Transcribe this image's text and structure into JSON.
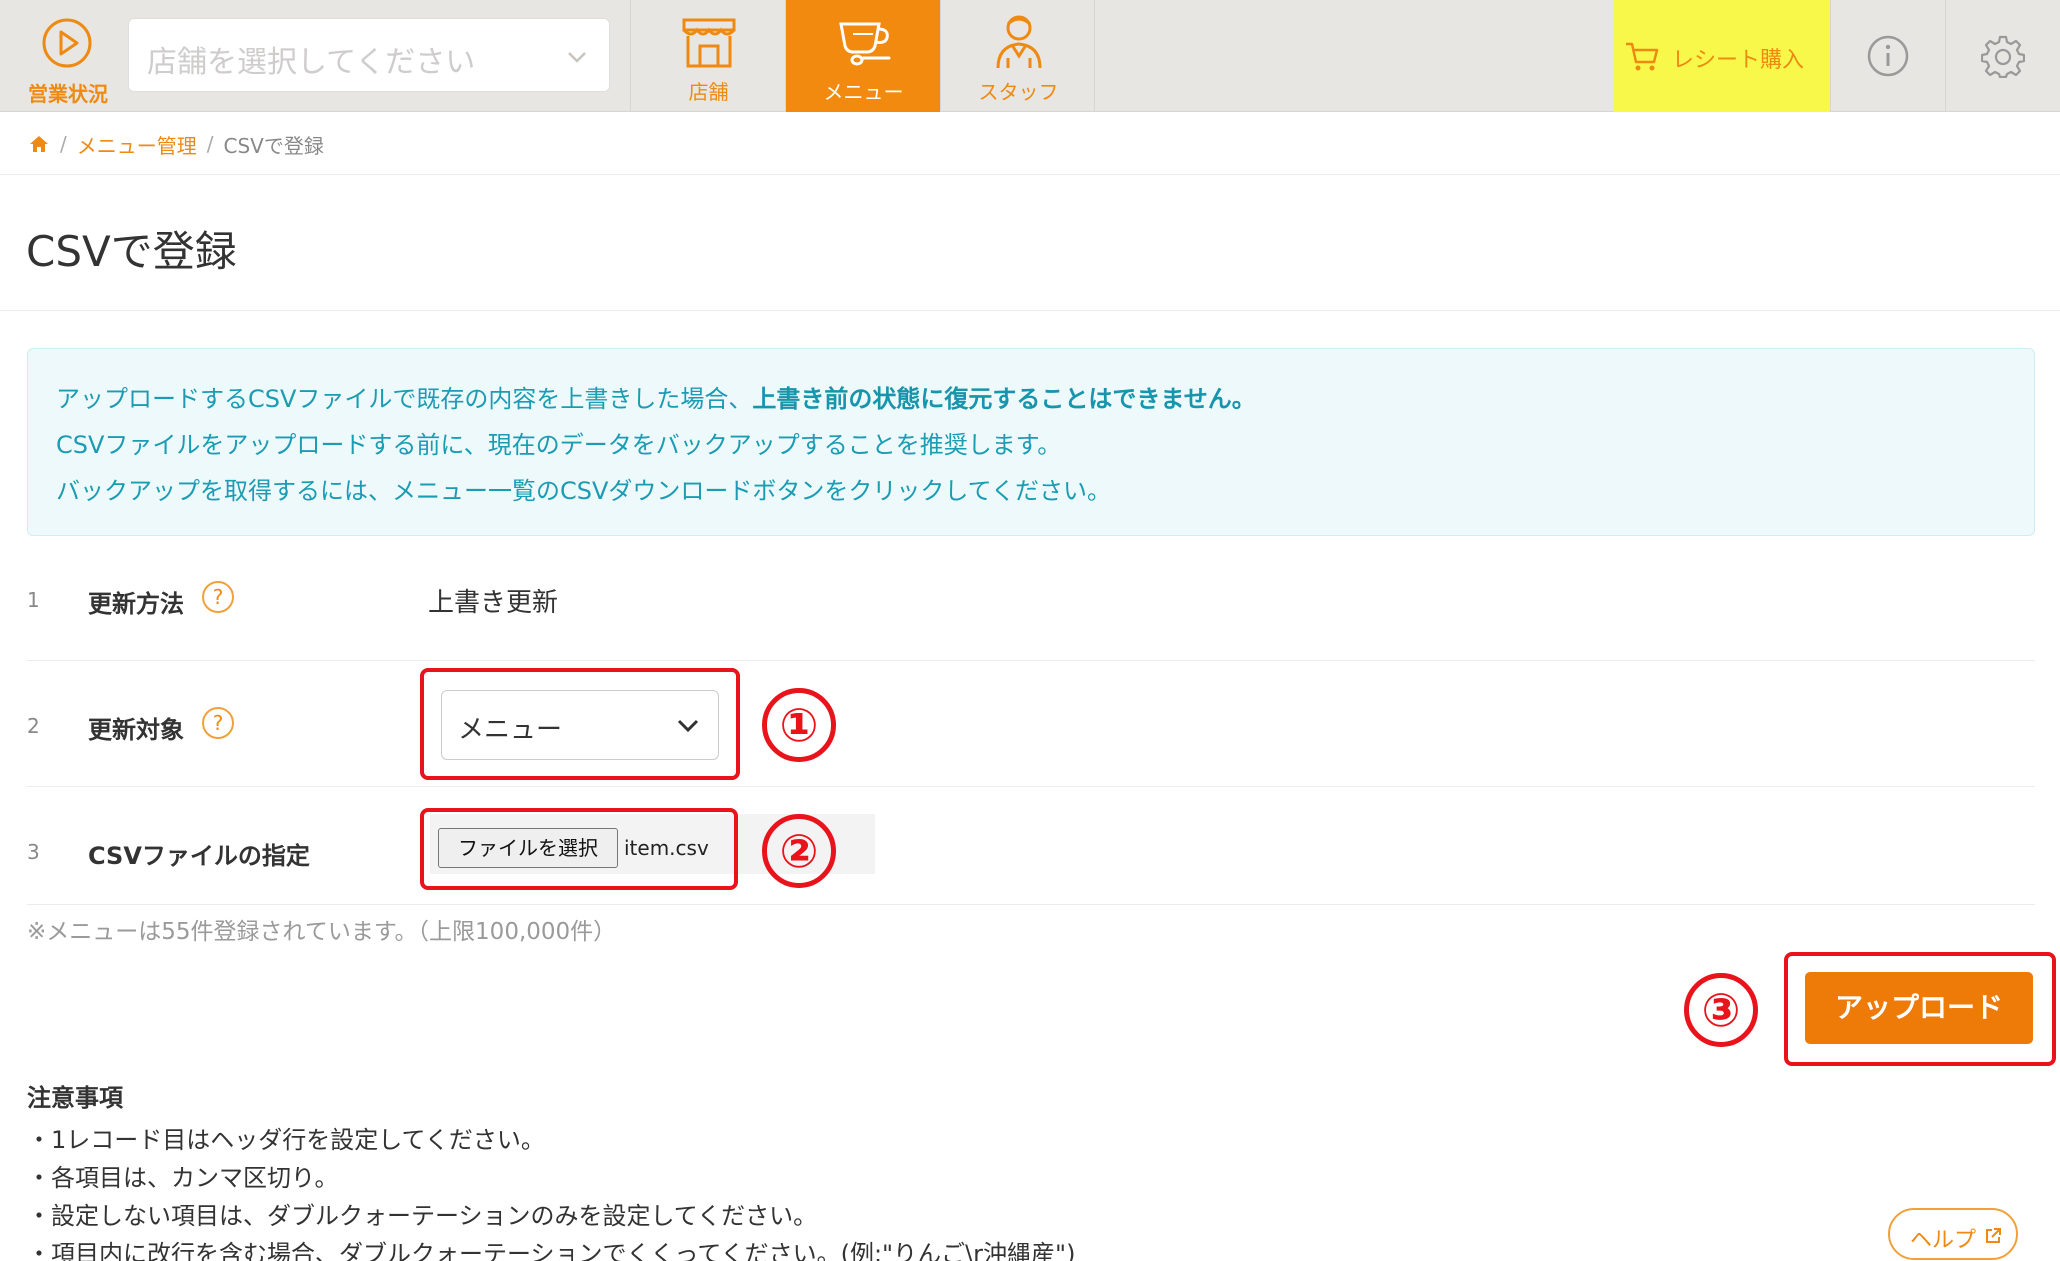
{
  "header": {
    "status_label": "営業状況",
    "store_select": {
      "placeholder": "店舗を選択してください"
    },
    "tabs": [
      {
        "label": "店舗",
        "icon": "store-icon",
        "active": false
      },
      {
        "label": "メニュー",
        "icon": "cup-icon",
        "active": true
      },
      {
        "label": "スタッフ",
        "icon": "staff-icon",
        "active": false
      }
    ],
    "receipt_button": "レシート購入",
    "info_icon": "info-icon",
    "settings_icon": "gear-icon"
  },
  "breadcrumb": {
    "home_icon": "home-icon",
    "items": [
      "メニュー管理",
      "CSVで登録"
    ]
  },
  "page_title": "CSVで登録",
  "notice": {
    "line1_plain": "アップロードするCSVファイルで既存の内容を上書きした場合、",
    "line1_strong": "上書き前の状態に復元することはできません。",
    "line2": "CSVファイルをアップロードする前に、現在のデータをバックアップすることを推奨します。",
    "line3": "バックアップを取得するには、メニュー一覧のCSVダウンロードボタンをクリックしてください。"
  },
  "form": {
    "rows": [
      {
        "num": "1",
        "label": "更新方法",
        "help": "?",
        "value": "上書き更新"
      },
      {
        "num": "2",
        "label": "更新対象",
        "help": "?",
        "value": "メニュー"
      },
      {
        "num": "3",
        "label": "CSVファイルの指定",
        "file_button": "ファイルを選択",
        "file_name": "item.csv"
      }
    ],
    "count_note": "※メニューは55件登録されています。（上限100,000件）",
    "upload_button": "アップロード"
  },
  "annotations": [
    "①",
    "②",
    "③"
  ],
  "notes": {
    "title": "注意事項",
    "items": [
      "・1レコード目はヘッダ行を設定してください。",
      "・各項目は、カンマ区切り。",
      "・設定しない項目は、ダブルクォーテーションのみを設定してください。",
      "・項目内に改行を含む場合、ダブルクォーテーションでくくってください。(例:\"りんご\\r沖縄産\")"
    ]
  },
  "help_link": "ヘルプ",
  "colors": {
    "accent": "#ee8a12",
    "active_tab": "#f28a0f",
    "receipt_bg": "#f8f84a",
    "notice_text": "#1b9cb3",
    "annotation_red": "#e8131b",
    "upload_bg": "#ee7a08"
  }
}
